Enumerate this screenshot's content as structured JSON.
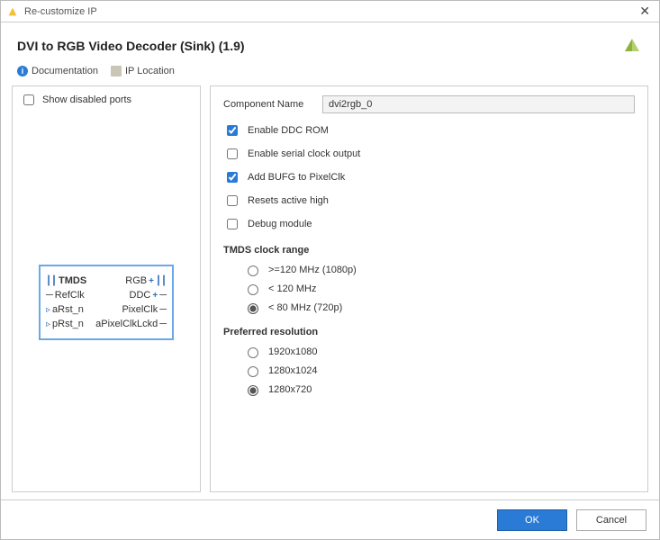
{
  "window": {
    "title": "Re-customize IP"
  },
  "header": {
    "ip_title": "DVI to RGB Video Decoder (Sink) (1.9)"
  },
  "links": {
    "documentation": "Documentation",
    "ip_location": "IP Location"
  },
  "left": {
    "show_disabled_label": "Show disabled ports",
    "ports": {
      "left": [
        "TMDS",
        "RefClk",
        "aRst_n",
        "pRst_n"
      ],
      "right": [
        "RGB",
        "DDC",
        "PixelClk",
        "aPixelClkLckd"
      ]
    }
  },
  "form": {
    "component_name_label": "Component Name",
    "component_name_value": "dvi2rgb_0",
    "checks": {
      "enable_ddc": {
        "label": "Enable DDC ROM",
        "checked": true
      },
      "enable_serial": {
        "label": "Enable serial clock output",
        "checked": false
      },
      "add_bufg": {
        "label": "Add BUFG to PixelClk",
        "checked": true
      },
      "resets_high": {
        "label": "Resets active high",
        "checked": false
      },
      "debug": {
        "label": "Debug module",
        "checked": false
      }
    },
    "tmds": {
      "title": "TMDS clock range",
      "options": [
        ">=120 MHz (1080p)",
        "< 120 MHz",
        "< 80 MHz (720p)"
      ],
      "selected": 2
    },
    "resolution": {
      "title": "Preferred resolution",
      "options": [
        "1920x1080",
        "1280x1024",
        "1280x720"
      ],
      "selected": 2
    }
  },
  "footer": {
    "ok": "OK",
    "cancel": "Cancel"
  }
}
